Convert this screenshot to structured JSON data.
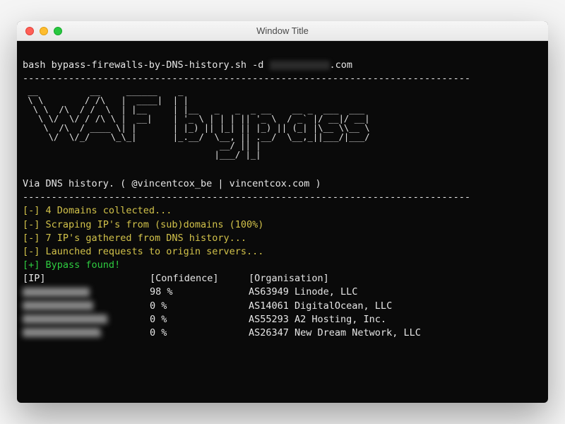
{
  "window": {
    "title": "Window Title"
  },
  "command": {
    "prefix": "bash bypass-firewalls-by-DNS-history.sh -d ",
    "suffix": ".com"
  },
  "divider": "------------------------------------------------------------------------------",
  "ascii": " __          __     ______    _\n \\ \\        / /\\   |  ____|  | |\n  \\ \\  /\\  / /  \\  | |__     | |__   _   _  _ __    __ _  ___  ___\n   \\ \\/  \\/ / /\\ \\ |  __|    | '_ \\ | | | || '_ \\  / _` |/ __|/ __|\n    \\  /\\  / ____ \\| |       | |_) || |_| || |_) || (_| |\\__ \\\\__ \\\n     \\/  \\/_/    \\_\\_|       |_.__/  \\__, || .__/  \\__,_||___/|___/\n                                      __/ || |\n                                     |___/ |_|",
  "subtitle": "Via DNS history. ( @vincentcox_be | vincentcox.com )",
  "status": [
    {
      "tag": "[-]",
      "cls": "yellow",
      "text": "4 Domains collected..."
    },
    {
      "tag": "[-]",
      "cls": "yellow",
      "text": "Scraping IP's from (sub)domains (100%)"
    },
    {
      "tag": "[-]",
      "cls": "yellow",
      "text": "7 IP's gathered from DNS history..."
    },
    {
      "tag": "[-]",
      "cls": "yellow",
      "text": "Launched requests to origin servers..."
    },
    {
      "tag": "[+]",
      "cls": "green",
      "text": "Bypass found!"
    }
  ],
  "table": {
    "headers": {
      "ip": "[IP]",
      "conf": "[Confidence]",
      "org": "[Organisation]"
    },
    "rows": [
      {
        "conf": "98 %",
        "org": "AS63949 Linode, LLC"
      },
      {
        "conf": "0 %",
        "org": "AS14061 DigitalOcean, LLC"
      },
      {
        "conf": "0 %",
        "org": "AS55293 A2 Hosting, Inc."
      },
      {
        "conf": "0 %",
        "org": "AS26347 New Dream Network, LLC"
      }
    ]
  }
}
